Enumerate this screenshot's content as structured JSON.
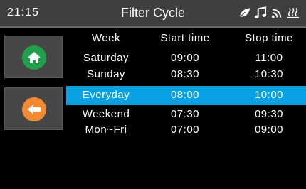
{
  "header": {
    "time": "21:15",
    "title": "Filter Cycle",
    "icons": [
      "leaf-icon",
      "music-icon",
      "wifi-signal-icon",
      "heating-icon"
    ]
  },
  "sidebar": {
    "home_icon": "home-icon",
    "back_icon": "back-arrow-icon",
    "colors": {
      "home": "#21a04b",
      "back": "#f28a34"
    }
  },
  "table": {
    "columns": [
      "Week",
      "Start time",
      "Stop time"
    ],
    "rows": [
      {
        "week": "Saturday",
        "start": "09:00",
        "stop": "11:00"
      },
      {
        "week": "Sunday",
        "start": "08:30",
        "stop": "10:30"
      },
      {
        "week": "Everyday",
        "start": "08:00",
        "stop": "10:00",
        "selected": true
      },
      {
        "week": "Weekend",
        "start": "07:30",
        "stop": "09:30"
      },
      {
        "week": "Mon~Fri",
        "start": "07:00",
        "stop": "09:00"
      }
    ],
    "selected_color": "#0aa0e6"
  }
}
